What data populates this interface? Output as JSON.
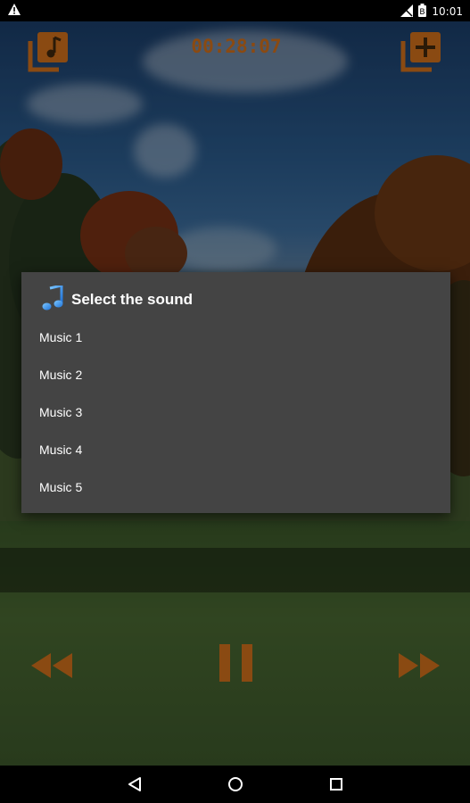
{
  "status_bar": {
    "time": "10:01",
    "warning_icon": "warning-triangle-icon",
    "icons": [
      "signal-muted-icon",
      "battery-icon"
    ]
  },
  "player": {
    "timer": "00:28:07",
    "top_left_icon": "music-playlist-icon",
    "top_right_icon": "add-playlist-icon",
    "controls": {
      "rewind_icon": "rewind-icon",
      "pause_icon": "pause-icon",
      "forward_icon": "fast-forward-icon"
    },
    "accent_color": "#8a4a12"
  },
  "dialog": {
    "title": "Select the sound",
    "title_icon": "music-note-icon",
    "items": [
      "Music 1",
      "Music 2",
      "Music 3",
      "Music 4",
      "Music 5"
    ]
  },
  "nav_bar": {
    "back_icon": "back-triangle-icon",
    "home_icon": "home-circle-icon",
    "recents_icon": "recents-square-icon"
  }
}
